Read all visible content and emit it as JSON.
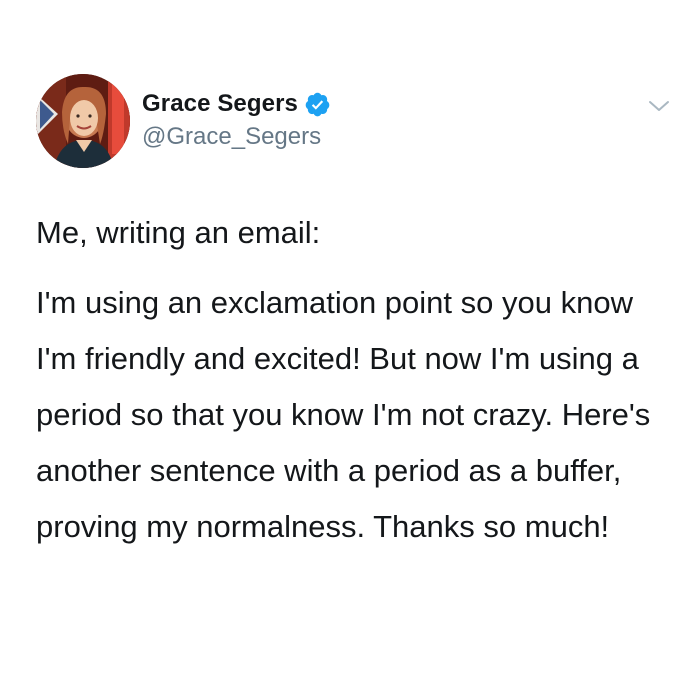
{
  "author": {
    "display_name": "Grace Segers",
    "handle": "@Grace_Segers",
    "verified": true,
    "verified_color": "#1da1f2"
  },
  "tweet": {
    "intro": "Me, writing an email:",
    "text": "I'm using an exclamation point so you know I'm friendly and excited! But now I'm using a period so that you know I'm not crazy. Here's another sentence with a period as a buffer, proving my normalness. Thanks so much!"
  },
  "icons": {
    "verified": "verified-badge-icon",
    "menu": "chevron-down-icon"
  }
}
